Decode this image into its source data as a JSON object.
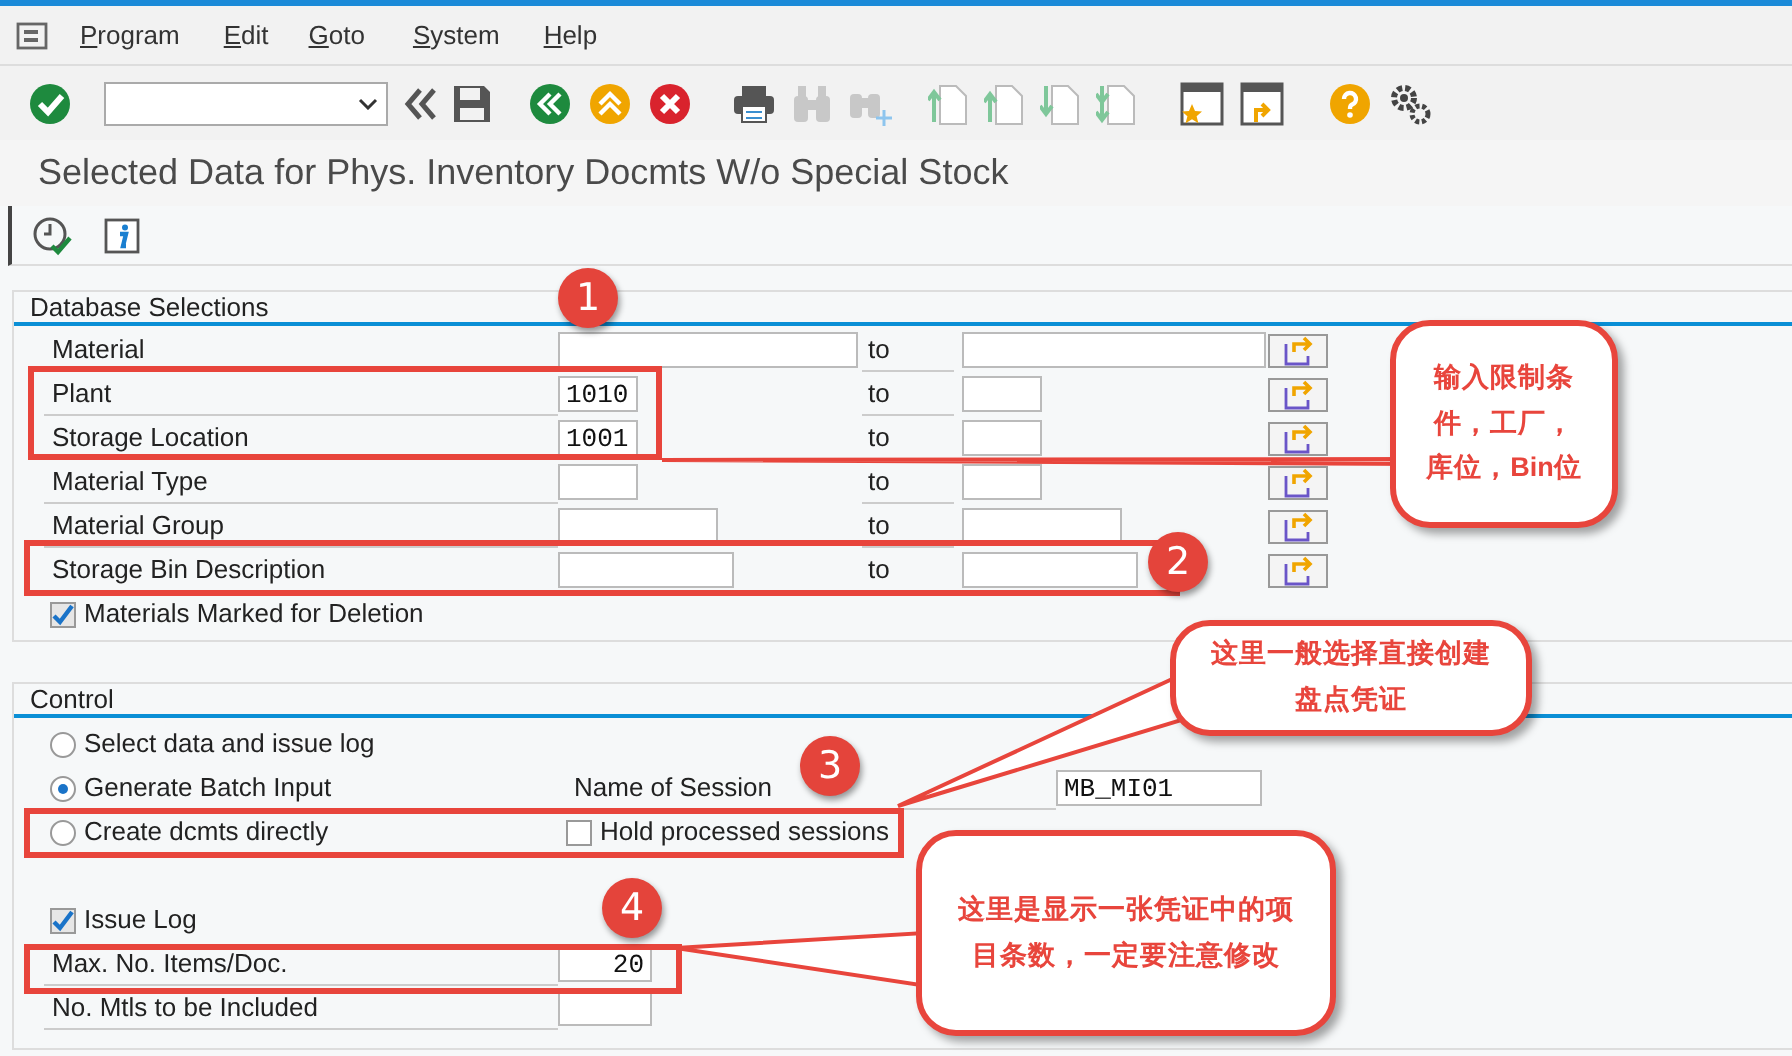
{
  "menu_bar": {
    "items": [
      "Program",
      "Edit",
      "Goto",
      "System",
      "Help"
    ]
  },
  "title": "Selected Data for Phys. Inventory Docmts W/o Special Stock",
  "database_selections": {
    "title": "Database Selections",
    "rows": [
      {
        "label": "Material",
        "to_label": "to"
      },
      {
        "label": "Plant",
        "low": "1010",
        "to_label": "to"
      },
      {
        "label": "Storage Location",
        "low": "1001",
        "to_label": "to"
      },
      {
        "label": "Material Type",
        "to_label": "to"
      },
      {
        "label": "Material Group",
        "to_label": "to"
      },
      {
        "label": "Storage Bin Description",
        "to_label": "to"
      }
    ],
    "deletion_checkbox": {
      "label": "Materials Marked for Deletion",
      "checked": true
    }
  },
  "control": {
    "title": "Control",
    "options": [
      {
        "label": "Select data and issue log",
        "selected": false
      },
      {
        "label": "Generate Batch Input",
        "selected": true
      },
      {
        "label": "Create dcmts directly",
        "selected": false
      }
    ],
    "session_name": {
      "label": "Name of Session",
      "value": "MB_MI01"
    },
    "hold_sessions": {
      "label": "Hold processed sessions",
      "checked": false
    },
    "issue_log": {
      "label": "Issue Log",
      "checked": true
    },
    "fields": [
      {
        "label": "Max. No. Items/Doc.",
        "value": "20"
      },
      {
        "label": "No. Mtls to be Included"
      }
    ]
  },
  "annotations": {
    "markers": [
      "1",
      "2",
      "3",
      "4"
    ],
    "callouts": [
      "输入限制条件，工厂，库位，Bin位",
      "这里一般选择直接创建盘点凭证",
      "这里是显示一张凭证中的项目条数，一定要注意修改"
    ]
  }
}
